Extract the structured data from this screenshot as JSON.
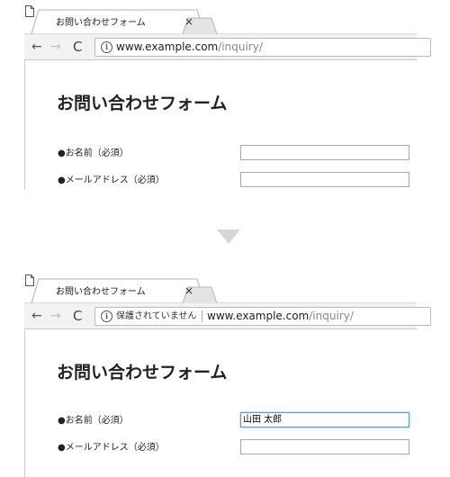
{
  "before": {
    "tab": {
      "title": "お問い合わせフォーム",
      "close": "×"
    },
    "nav": {
      "back": "←",
      "forward": "→",
      "reload": "C"
    },
    "address": {
      "host": "www.example.com",
      "path": "/inquiry/",
      "security_label": ""
    },
    "page": {
      "title": "お問い合わせフォーム",
      "fields": [
        {
          "label": "●お名前（必須）",
          "value": ""
        },
        {
          "label": "●メールアドレス（必須）",
          "value": ""
        }
      ]
    }
  },
  "after": {
    "tab": {
      "title": "お問い合わせフォーム",
      "close": "×"
    },
    "nav": {
      "back": "←",
      "forward": "→",
      "reload": "C"
    },
    "address": {
      "host": "www.example.com",
      "path": "/inquiry/",
      "security_label": "保護されていません"
    },
    "page": {
      "title": "お問い合わせフォーム",
      "fields": [
        {
          "label": "●お名前（必須）",
          "value": "山田 太郎"
        },
        {
          "label": "●メールアドレス（必須）",
          "value": ""
        }
      ]
    }
  },
  "icons": {
    "page": "page-icon",
    "info": "info-icon",
    "transition": "down-arrow-icon"
  },
  "colors": {
    "focus_border": "#5b9bd5",
    "url_path": "#888888",
    "arrow": "#d6d6d6"
  }
}
